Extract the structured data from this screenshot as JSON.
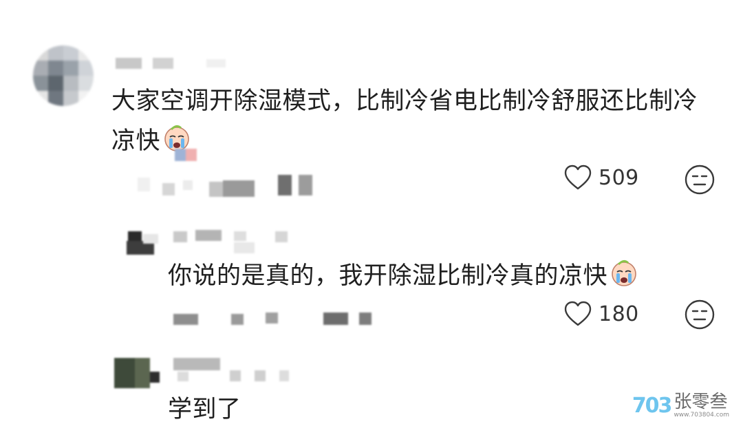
{
  "comments": [
    {
      "text": "大家空调开除湿模式，比制冷省电比制冷舒服还比制冷凉快",
      "line1": "大家空调开除湿模式，比制冷省电比制冷舒服还比制冷",
      "line2": "凉快",
      "likes": "509",
      "like_icon": "heart-outline-icon",
      "react_icon": "expressionless-face-icon"
    },
    {
      "text": "你说的是真的，我开除湿比制冷真的凉快",
      "likes": "180",
      "like_icon": "heart-outline-icon",
      "react_icon": "expressionless-face-icon"
    },
    {
      "text": "学到了"
    }
  ],
  "emoji": "crying-face-emoji",
  "watermark": {
    "logo": "703",
    "name": "张零叁",
    "url": "www.703804.com"
  },
  "colors": {
    "text": "#1f1f1f",
    "muted": "#333333",
    "icon": "#3a3a3a",
    "watermark_blue": "#6ec5ee",
    "watermark_pink": "#f28bb6"
  }
}
